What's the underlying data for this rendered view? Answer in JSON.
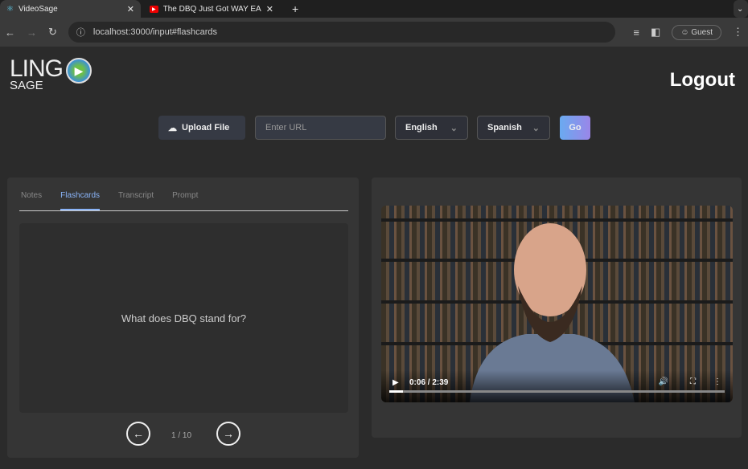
{
  "browser": {
    "tabs": [
      {
        "title": "VideoSage"
      },
      {
        "title": "The DBQ Just Got WAY EASIE"
      }
    ],
    "url": "localhost:3000/input#flashcards",
    "profile": "Guest"
  },
  "header": {
    "logo_top": "LING",
    "logo_bottom": "SAGE",
    "logout": "Logout"
  },
  "controls": {
    "upload": "Upload File",
    "url_placeholder": "Enter URL",
    "source_lang": "English",
    "target_lang": "Spanish",
    "go": "Go"
  },
  "panel": {
    "tabs": [
      "Notes",
      "Flashcards",
      "Transcript",
      "Prompt"
    ],
    "active_tab": "Flashcards",
    "card_text": "What does DBQ stand for?",
    "counter": "1 / 10"
  },
  "video": {
    "time": "0:06 / 2:39",
    "progress": 0.04
  }
}
